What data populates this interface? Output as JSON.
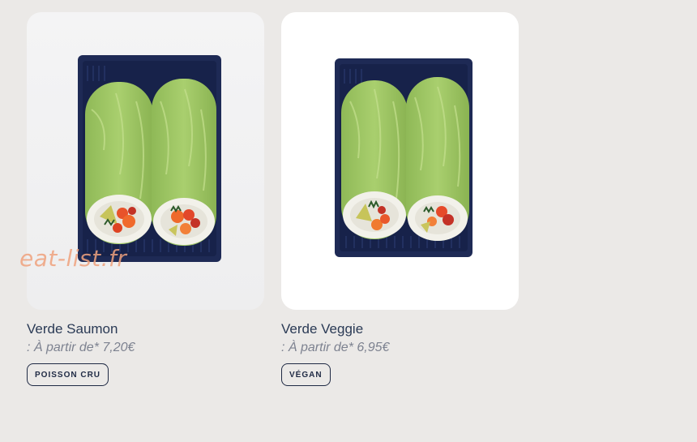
{
  "products": [
    {
      "name": "Verde Saumon",
      "price": ": À partir de* 7,20€",
      "tag": "POISSON CRU",
      "image": "salmon-lettuce-roll-tray"
    },
    {
      "name": "Verde Veggie",
      "price": ": À partir de* 6,95€",
      "tag": "VÉGAN",
      "image": "veggie-lettuce-roll-tray"
    }
  ],
  "watermark": "eat-list.fr",
  "colors": {
    "page_bg": "#ebe9e7",
    "title": "#2a3a55",
    "price": "#7d8290",
    "tag_border": "#1f2a44",
    "tray": "#1e2a55",
    "lettuce": "#9cc263",
    "watermark": "#f0a27e"
  }
}
